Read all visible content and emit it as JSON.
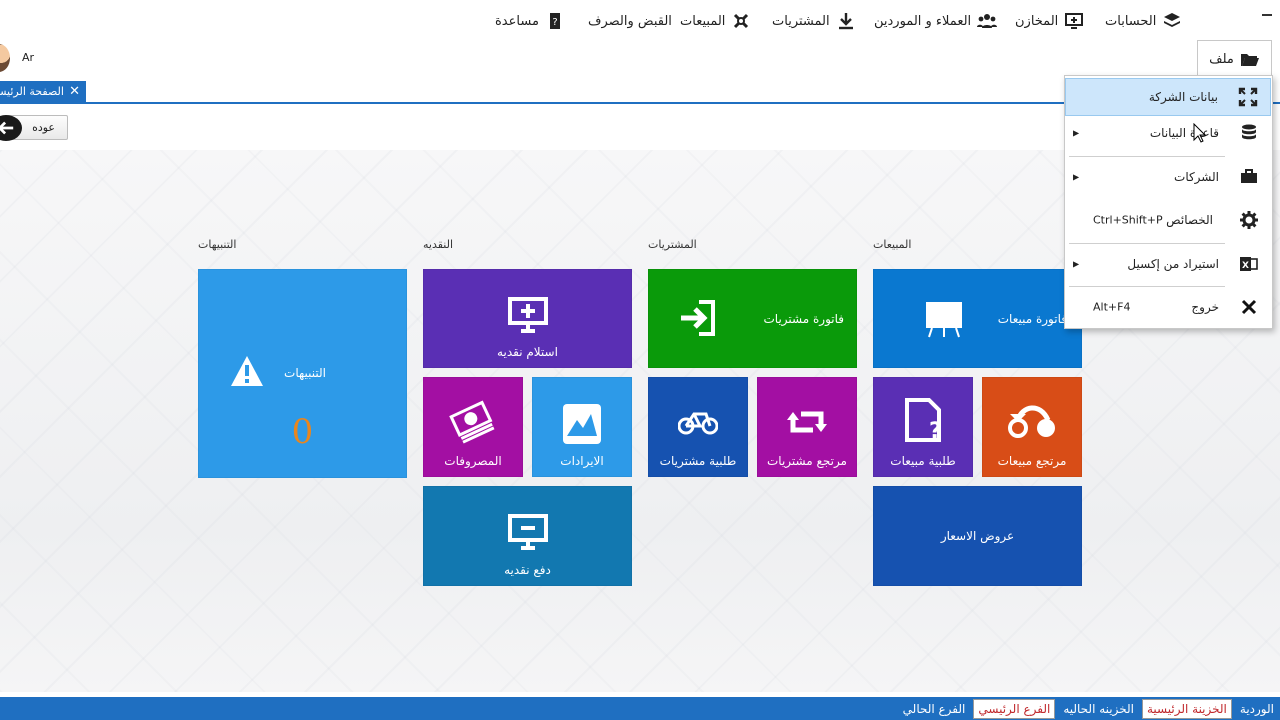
{
  "window": {
    "minimize_icon": "minimize-icon"
  },
  "user": {
    "label": "Ar"
  },
  "menu": {
    "file": "ملف",
    "accounts": "الحسابات",
    "stores": "المخازن",
    "customers": "العملاء و الموردين",
    "purchases": "المشتريات",
    "sales": "المبيعات",
    "receipts": "القبض والصرف",
    "help": "مساعدة"
  },
  "tab": {
    "label": "الصفحة الرئيسية"
  },
  "back": {
    "label": "عوده"
  },
  "groups": {
    "sales": "المبيعات",
    "purchases": "المشتريات",
    "cash": "النقديه",
    "alerts": "التنبيهات"
  },
  "tiles": {
    "sales_invoice": "فاتورة مبيعات",
    "sales_return": "مرتجع مبيعات",
    "sales_order": "طلبية مبيعات",
    "quotes": "عروض الاسعار",
    "purchase_invoice": "فاتورة مشتريات",
    "purchase_return": "مرتجع مشتريات",
    "purchase_order": "طلبية مشتريات",
    "cash_receive": "استلام نقديه",
    "revenues": "الايرادات",
    "expenses": "المصروفات",
    "cash_pay": "دفع نقديه",
    "alerts": "التنبيهات",
    "alerts_count": "0"
  },
  "file_menu": {
    "company_data": "بيانات الشركة",
    "database": "قاعدة البيانات",
    "companies": "الشركات",
    "properties": "الخصائص",
    "properties_shortcut": "Ctrl+Shift+P",
    "import_excel": "استيراد من إكسيل",
    "exit": "خروج",
    "exit_shortcut": "Alt+F4"
  },
  "status": {
    "shift": "الوردية",
    "main_treasury": "الخزينة الرئيسية",
    "current_treasury": "الخزينه الحاليه",
    "main_branch": "الفرع الرئيسي",
    "current_branch": "الفرع الحالي"
  },
  "colors": {
    "accent": "#1f6fc1",
    "tile_blue": "#0a78d0",
    "tile_orange": "#d84d17",
    "tile_purple": "#5a2fb4",
    "tile_green": "#0a9a0a",
    "tile_magenta": "#a30fa3",
    "tile_navy": "#1652b0",
    "tile_sky": "#2d9ae8",
    "tile_teal": "#1278b0"
  }
}
